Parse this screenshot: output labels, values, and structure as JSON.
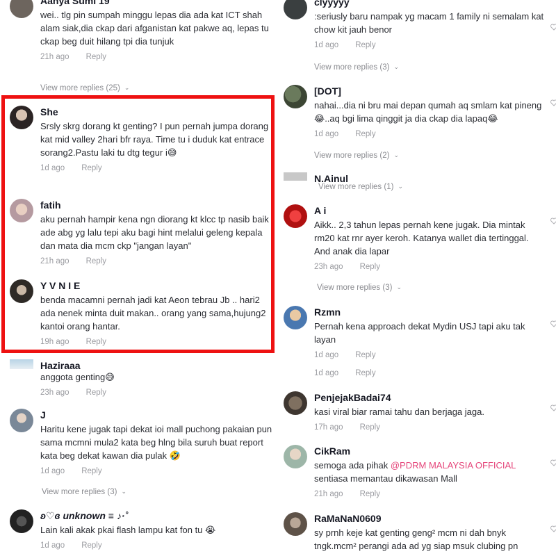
{
  "left": {
    "c0": {
      "username": "Aanya Sumi 19",
      "text": "wei.. tlg pin sumpah minggu lepas dia ada kat ICT shah alam siak,dia ckap dari afganistan kat pakwe aq, lepas tu ckap beg duit hilang tpi dia tunjuk",
      "age": "21h ago",
      "reply": "Reply",
      "more": "View more replies (25)"
    },
    "c1": {
      "username": "She",
      "text": "Srsly skrg dorang kt genting? I pun pernah jumpa dorang kat mid valley 2hari bfr raya. Time tu i duduk kat entrace sorang2.Pastu laki tu dtg tegur i😅",
      "age": "1d ago",
      "reply": "Reply"
    },
    "c2": {
      "username": "fatih",
      "text": "aku pernah hampir kena ngn diorang kt klcc tp nasib baik ade abg yg lalu tepi aku bagi hint melalui geleng kepala dan mata dia mcm ckp \"jangan layan\"",
      "age": "21h ago",
      "reply": "Reply"
    },
    "c3": {
      "username": "Y V N I E",
      "text": "benda macamni pernah jadi kat Aeon tebrau Jb .. hari2 ada nenek minta duit makan.. orang yang sama,hujung2 kantoi orang hantar.",
      "age": "19h ago",
      "reply": "Reply"
    },
    "c4": {
      "username": "Haziraaa",
      "text": "anggota genting😅",
      "age": "23h ago",
      "reply": "Reply"
    },
    "c5": {
      "username": "J",
      "text": "Haritu kene jugak tapi dekat ioi mall puchong pakaian pun sama mcmni mula2 kata beg hlng bila suruh buat report kata beg dekat kawan dia pulak 🤣",
      "age": "1d ago",
      "reply": "Reply",
      "more": "View more replies (3)"
    },
    "c6": {
      "username": "ʚ♡ɞ unknown ≡ ♪·˚",
      "text": "Lain kali akak pkai flash lampu kat fon tu 😭",
      "age": "1d ago",
      "reply": "Reply"
    }
  },
  "right": {
    "c0": {
      "username": "clyyyyy",
      "text": ":seriusly baru nampak yg macam 1 family ni semalam kat chow kit jauh benor",
      "age": "1d ago",
      "reply": "Reply",
      "more": "View more replies (3)"
    },
    "c1": {
      "username": "[DOT]",
      "text": "nahai...dia ni bru mai depan qumah aq smlam kat pineng😂..aq bgi lima qinggit ja dia ckap dia lapaq😂",
      "age": "1d ago",
      "reply": "Reply",
      "more": "View more replies (2)"
    },
    "c2": {
      "username": "N.Ainul",
      "more": "View more replies (1)"
    },
    "c3": {
      "username": "A i",
      "text": "Aikk.. 2,3 tahun lepas pernah kene jugak. Dia mintak rm20 kat rnr ayer keroh. Katanya wallet dia tertinggal. And anak dia lapar",
      "age": "23h ago",
      "reply": "Reply",
      "more": "View more replies (3)"
    },
    "c4": {
      "username": "Rzmn",
      "text": "Pernah kena approach dekat Mydin USJ tapi aku tak layan",
      "age": "1d ago",
      "reply": "Reply",
      "age2": "1d ago",
      "reply2": "Reply"
    },
    "c5": {
      "username": "PenjejakBadai74",
      "text": "kasi viral biar ramai tahu dan berjaga jaga.",
      "age": "17h ago",
      "reply": "Reply"
    },
    "c6": {
      "username": "CikRam",
      "text_pre": "semoga ada pihak ",
      "mention": "@PDRM MALAYSIA OFFICIAL",
      "text_post": "sentiasa memantau dikawasan Mall",
      "age": "21h ago",
      "reply": "Reply"
    },
    "c7": {
      "username": "RaMaNaN0609",
      "text": "sy prnh keje kat genting geng² mcm ni dah bnyk tngk.mcm² perangi ada ad yg siap msuk clubing pn"
    }
  },
  "colors": {
    "highlight": "#ee1111",
    "mention": "#e5457a",
    "meta": "#9a9ba0"
  }
}
